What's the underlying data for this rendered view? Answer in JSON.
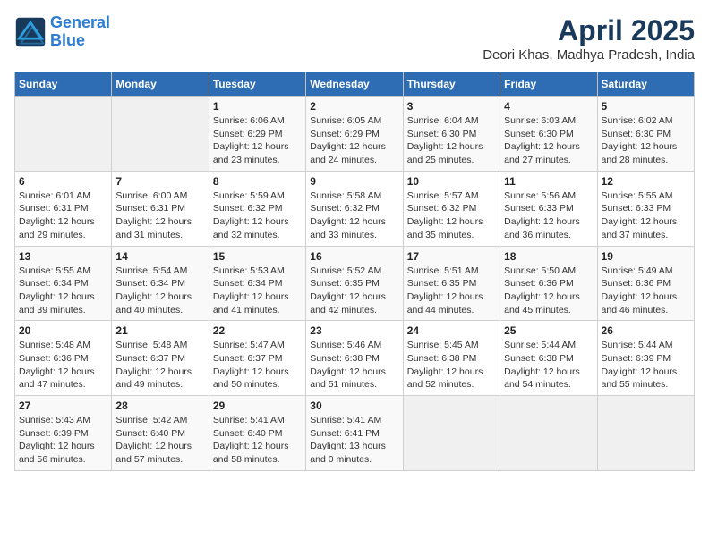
{
  "header": {
    "logo_line1": "General",
    "logo_line2": "Blue",
    "title": "April 2025",
    "subtitle": "Deori Khas, Madhya Pradesh, India"
  },
  "weekdays": [
    "Sunday",
    "Monday",
    "Tuesday",
    "Wednesday",
    "Thursday",
    "Friday",
    "Saturday"
  ],
  "weeks": [
    [
      {
        "day": "",
        "info": ""
      },
      {
        "day": "",
        "info": ""
      },
      {
        "day": "1",
        "info": "Sunrise: 6:06 AM\nSunset: 6:29 PM\nDaylight: 12 hours and 23 minutes."
      },
      {
        "day": "2",
        "info": "Sunrise: 6:05 AM\nSunset: 6:29 PM\nDaylight: 12 hours and 24 minutes."
      },
      {
        "day": "3",
        "info": "Sunrise: 6:04 AM\nSunset: 6:30 PM\nDaylight: 12 hours and 25 minutes."
      },
      {
        "day": "4",
        "info": "Sunrise: 6:03 AM\nSunset: 6:30 PM\nDaylight: 12 hours and 27 minutes."
      },
      {
        "day": "5",
        "info": "Sunrise: 6:02 AM\nSunset: 6:30 PM\nDaylight: 12 hours and 28 minutes."
      }
    ],
    [
      {
        "day": "6",
        "info": "Sunrise: 6:01 AM\nSunset: 6:31 PM\nDaylight: 12 hours and 29 minutes."
      },
      {
        "day": "7",
        "info": "Sunrise: 6:00 AM\nSunset: 6:31 PM\nDaylight: 12 hours and 31 minutes."
      },
      {
        "day": "8",
        "info": "Sunrise: 5:59 AM\nSunset: 6:32 PM\nDaylight: 12 hours and 32 minutes."
      },
      {
        "day": "9",
        "info": "Sunrise: 5:58 AM\nSunset: 6:32 PM\nDaylight: 12 hours and 33 minutes."
      },
      {
        "day": "10",
        "info": "Sunrise: 5:57 AM\nSunset: 6:32 PM\nDaylight: 12 hours and 35 minutes."
      },
      {
        "day": "11",
        "info": "Sunrise: 5:56 AM\nSunset: 6:33 PM\nDaylight: 12 hours and 36 minutes."
      },
      {
        "day": "12",
        "info": "Sunrise: 5:55 AM\nSunset: 6:33 PM\nDaylight: 12 hours and 37 minutes."
      }
    ],
    [
      {
        "day": "13",
        "info": "Sunrise: 5:55 AM\nSunset: 6:34 PM\nDaylight: 12 hours and 39 minutes."
      },
      {
        "day": "14",
        "info": "Sunrise: 5:54 AM\nSunset: 6:34 PM\nDaylight: 12 hours and 40 minutes."
      },
      {
        "day": "15",
        "info": "Sunrise: 5:53 AM\nSunset: 6:34 PM\nDaylight: 12 hours and 41 minutes."
      },
      {
        "day": "16",
        "info": "Sunrise: 5:52 AM\nSunset: 6:35 PM\nDaylight: 12 hours and 42 minutes."
      },
      {
        "day": "17",
        "info": "Sunrise: 5:51 AM\nSunset: 6:35 PM\nDaylight: 12 hours and 44 minutes."
      },
      {
        "day": "18",
        "info": "Sunrise: 5:50 AM\nSunset: 6:36 PM\nDaylight: 12 hours and 45 minutes."
      },
      {
        "day": "19",
        "info": "Sunrise: 5:49 AM\nSunset: 6:36 PM\nDaylight: 12 hours and 46 minutes."
      }
    ],
    [
      {
        "day": "20",
        "info": "Sunrise: 5:48 AM\nSunset: 6:36 PM\nDaylight: 12 hours and 47 minutes."
      },
      {
        "day": "21",
        "info": "Sunrise: 5:48 AM\nSunset: 6:37 PM\nDaylight: 12 hours and 49 minutes."
      },
      {
        "day": "22",
        "info": "Sunrise: 5:47 AM\nSunset: 6:37 PM\nDaylight: 12 hours and 50 minutes."
      },
      {
        "day": "23",
        "info": "Sunrise: 5:46 AM\nSunset: 6:38 PM\nDaylight: 12 hours and 51 minutes."
      },
      {
        "day": "24",
        "info": "Sunrise: 5:45 AM\nSunset: 6:38 PM\nDaylight: 12 hours and 52 minutes."
      },
      {
        "day": "25",
        "info": "Sunrise: 5:44 AM\nSunset: 6:38 PM\nDaylight: 12 hours and 54 minutes."
      },
      {
        "day": "26",
        "info": "Sunrise: 5:44 AM\nSunset: 6:39 PM\nDaylight: 12 hours and 55 minutes."
      }
    ],
    [
      {
        "day": "27",
        "info": "Sunrise: 5:43 AM\nSunset: 6:39 PM\nDaylight: 12 hours and 56 minutes."
      },
      {
        "day": "28",
        "info": "Sunrise: 5:42 AM\nSunset: 6:40 PM\nDaylight: 12 hours and 57 minutes."
      },
      {
        "day": "29",
        "info": "Sunrise: 5:41 AM\nSunset: 6:40 PM\nDaylight: 12 hours and 58 minutes."
      },
      {
        "day": "30",
        "info": "Sunrise: 5:41 AM\nSunset: 6:41 PM\nDaylight: 13 hours and 0 minutes."
      },
      {
        "day": "",
        "info": ""
      },
      {
        "day": "",
        "info": ""
      },
      {
        "day": "",
        "info": ""
      }
    ]
  ]
}
